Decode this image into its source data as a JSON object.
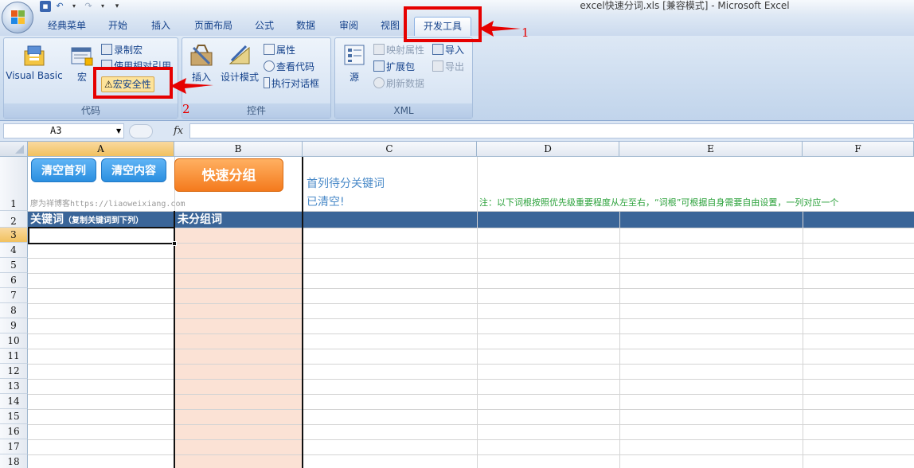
{
  "window": {
    "title": "excel快速分词.xls [兼容模式] - Microsoft Excel"
  },
  "tabs": [
    "经典菜单",
    "开始",
    "插入",
    "页面布局",
    "公式",
    "数据",
    "审阅",
    "视图",
    "开发工具"
  ],
  "active_tab": "开发工具",
  "ribbon": {
    "code": {
      "label": "代码",
      "visual_basic": "Visual Basic",
      "macro": "宏",
      "record_macro": "录制宏",
      "relative_ref": "使用相对引用",
      "macro_security": "宏安全性"
    },
    "controls": {
      "label": "控件",
      "insert": "插入",
      "design_mode": "设计模式",
      "properties": "属性",
      "view_code": "查看代码",
      "run_dialog": "执行对话框"
    },
    "xml": {
      "label": "XML",
      "source": "源",
      "map_properties": "映射属性",
      "expansion_pack": "扩展包",
      "refresh_data": "刷新数据",
      "import": "导入",
      "export": "导出"
    }
  },
  "formula_bar": {
    "name_box": "A3",
    "fx": "fx",
    "formula": ""
  },
  "columns": [
    "A",
    "B",
    "C",
    "D",
    "E",
    "F"
  ],
  "rows": [
    "1",
    "2",
    "3",
    "4",
    "5",
    "6",
    "7",
    "8",
    "9",
    "10",
    "11",
    "12",
    "13",
    "14",
    "15",
    "16",
    "17",
    "18"
  ],
  "sheet": {
    "btn_clear_first_col": "清空首列",
    "btn_clear_content": "清空内容",
    "btn_quick_group": "快速分组",
    "a1_credit": "廖为祥博客https://liaoweixiang.com",
    "c1_line1": "首列待分关键词",
    "c1_line2": "已清空!",
    "d1_note": "注：以下词根按照优先级重要程度从左至右，“词根”可根据自身需要自由设置，一列对应一个",
    "a2_header": "关键词",
    "a2_hint": "（复制关键词到下列）",
    "b2_header": "未分组词"
  },
  "annotations": {
    "marker_1": "1",
    "marker_2": "2"
  },
  "colors": {
    "header_band": "#3a6598",
    "unsorted_column": "#fbe2d5",
    "accent_red": "#e60000",
    "note_green": "#2aa13a",
    "status_blue": "#4a8ac8"
  }
}
